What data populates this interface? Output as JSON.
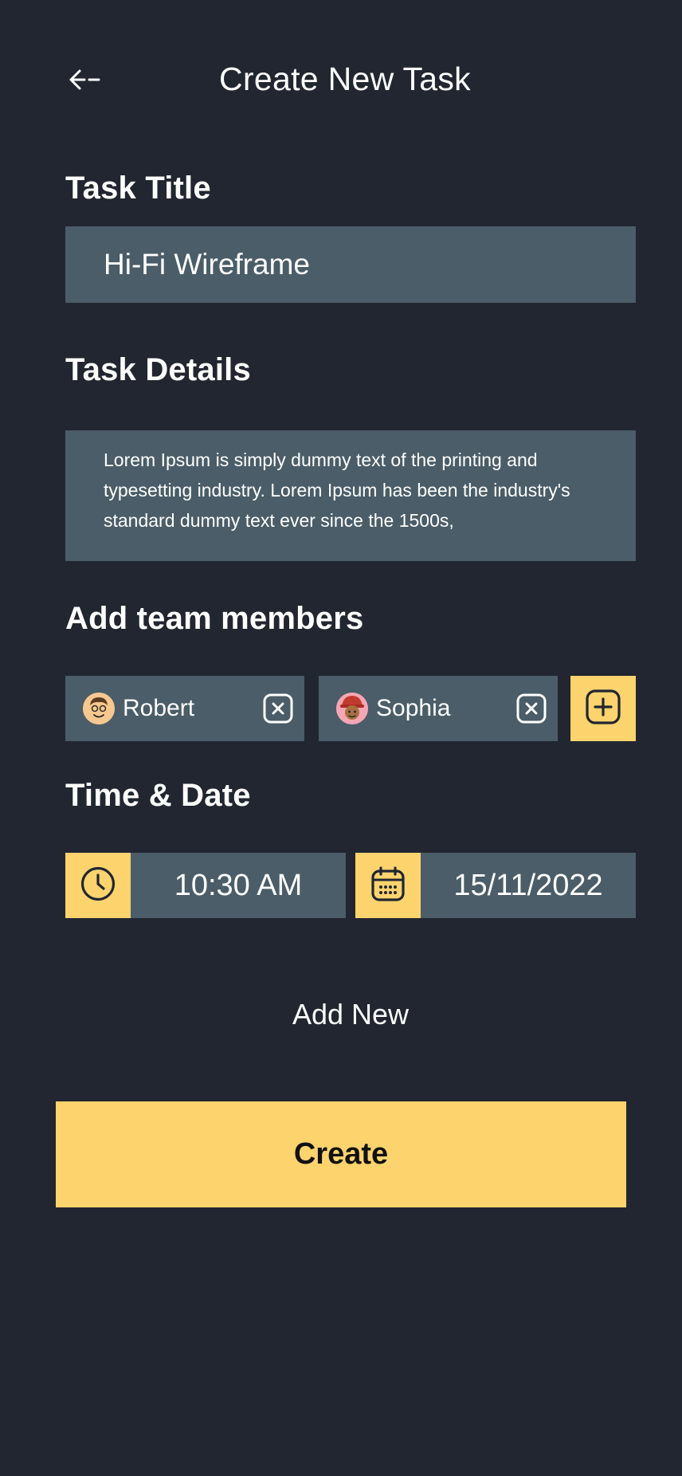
{
  "header": {
    "title": "Create New Task",
    "back_icon": "arrow-left-icon"
  },
  "task_title": {
    "heading": "Task Title",
    "value": "Hi-Fi Wireframe"
  },
  "task_details": {
    "heading": "Task Details",
    "value": "Lorem Ipsum is simply dummy text of the printing and typesetting industry. Lorem Ipsum has been the industry's standard dummy text ever since the 1500s,"
  },
  "team": {
    "heading": "Add team members",
    "members": [
      {
        "name": "Robert",
        "avatar_color": "#f6c88f",
        "remove_icon": "close-square-icon"
      },
      {
        "name": "Sophia",
        "avatar_color": "#f4a6b4",
        "remove_icon": "close-square-icon"
      }
    ],
    "add_icon": "plus-square-icon"
  },
  "schedule": {
    "heading": "Time & Date",
    "time": {
      "icon": "clock-icon",
      "value": "10:30 AM"
    },
    "date": {
      "icon": "calendar-icon",
      "value": "15/11/2022"
    }
  },
  "actions": {
    "add_new_label": "Add New",
    "create_label": "Create"
  },
  "colors": {
    "background": "#212630",
    "field": "#4a5d68",
    "accent": "#fdd36e"
  }
}
